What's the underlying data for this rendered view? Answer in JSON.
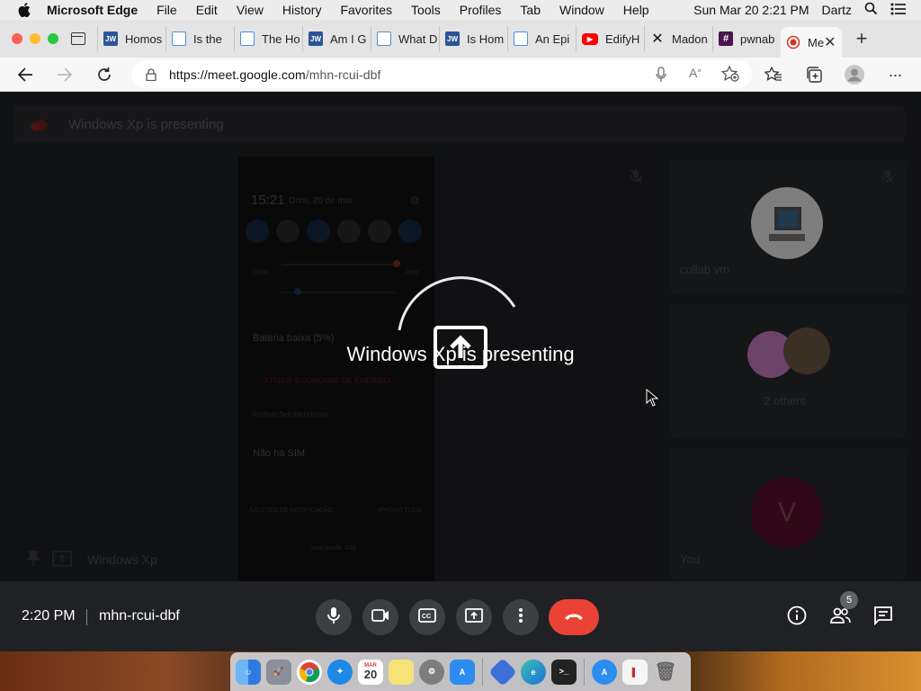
{
  "menubar": {
    "app_name": "Microsoft Edge",
    "items": [
      "File",
      "Edit",
      "View",
      "History",
      "Favorites",
      "Tools",
      "Profiles",
      "Tab",
      "Window",
      "Help"
    ],
    "datetime": "Sun Mar 20  2:21 PM",
    "user": "Dartz"
  },
  "tabs": [
    {
      "label": "Homos",
      "icon": "jw-icon",
      "color": "#2b5597"
    },
    {
      "label": "Is the",
      "icon": "bookmark-icon",
      "color": "#4a90d9"
    },
    {
      "label": "The Ho",
      "icon": "bookmark-icon",
      "color": "#4a90d9"
    },
    {
      "label": "Am I G",
      "icon": "jw-icon",
      "color": "#2b5597"
    },
    {
      "label": "What D",
      "icon": "bookmark-icon",
      "color": "#4a90d9"
    },
    {
      "label": "Is Hom",
      "icon": "jw-icon",
      "color": "#2b5597"
    },
    {
      "label": "An Epi",
      "icon": "bookmark-icon",
      "color": "#4a90d9"
    },
    {
      "label": "EdifyH",
      "icon": "youtube-icon",
      "color": "#ff0000"
    },
    {
      "label": "Madon",
      "icon": "x-logo-icon",
      "color": "#111111"
    },
    {
      "label": "pwnab",
      "icon": "slack-icon",
      "color": "#4a154b"
    }
  ],
  "active_tab": {
    "label": "Me",
    "icon": "meet-record-icon",
    "color": "#d93025"
  },
  "address": {
    "host": "https://meet.google.com",
    "path": "/mhn-rcui-dbf"
  },
  "meet": {
    "banner_text": "Windows Xp is presenting",
    "presenting_text": "Windows Xp is presenting",
    "presenter_name": "Windows Xp",
    "phone": {
      "time": "15:21",
      "date": "Dom, 20 de mar",
      "battery_title": "Bateria baixa (5%)",
      "battery_action": "ATIVAR ECONOMIA DE ENERGIA",
      "notif_header": "notificações silenciosas",
      "sim_title": "Não há SIM",
      "footer_left": "AJUSTES DE NOTIFICAÇÃO",
      "footer_right": "APAGAR TUDO",
      "carrier": "Sem cartão SIM",
      "brightness_left": "100%",
      "brightness_right": "Auto"
    },
    "participants": [
      {
        "name": "collab vm"
      },
      {
        "name": "2 others"
      },
      {
        "name": "You",
        "initial": "V"
      }
    ],
    "bottom": {
      "time": "2:20 PM",
      "meeting_code": "mhn-rcui-dbf",
      "people_count": "5"
    }
  },
  "colors": {
    "end_call": "#ea4335",
    "avatar_you": "#c2185b"
  }
}
